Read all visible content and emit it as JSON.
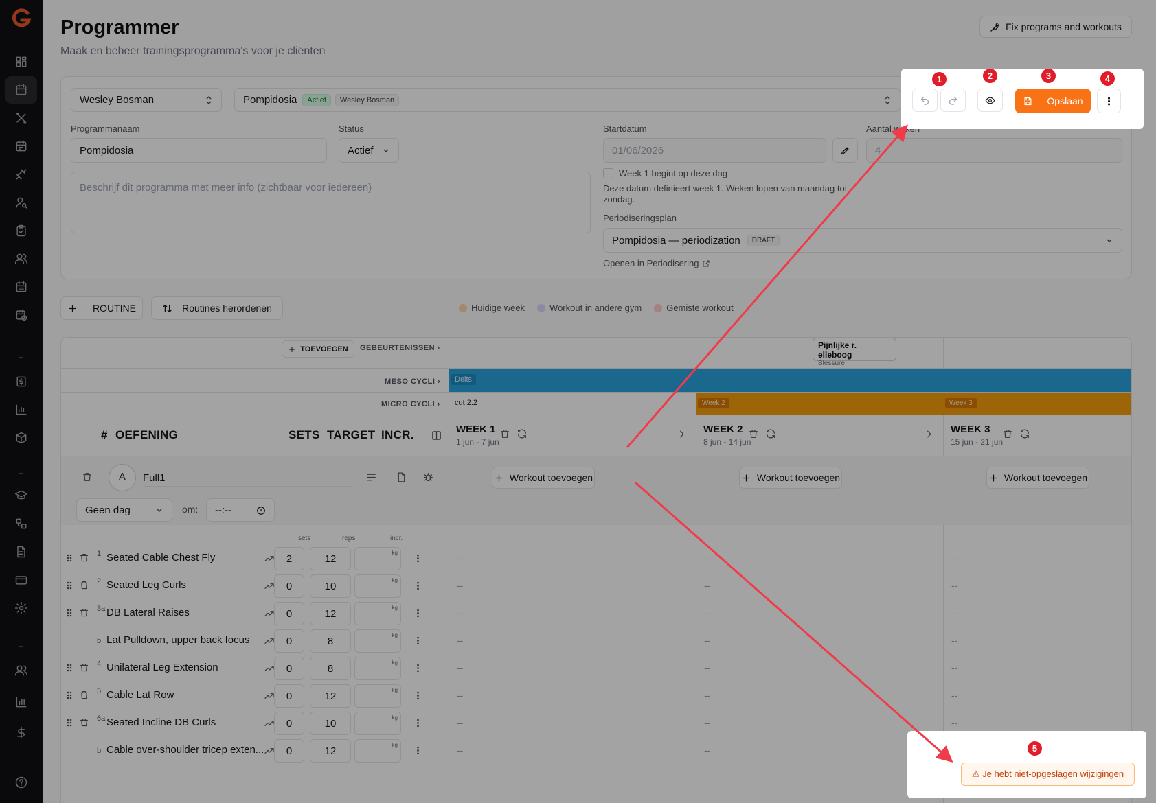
{
  "header": {
    "title": "Programmer",
    "subtitle": "Maak en beheer trainingsprogramma's voor je cliënten",
    "fix_button": "Fix programs and workouts"
  },
  "form": {
    "client_select": "Wesley Bosman",
    "program_select": "Pompidosia",
    "program_status_badge": "Actief",
    "program_owner_badge": "Wesley Bosman",
    "name_label": "Programmanaam",
    "name_value": "Pompidosia",
    "status_label": "Status",
    "status_value": "Actief",
    "description_placeholder": "Beschrijf dit programma met meer info (zichtbaar voor iedereen)",
    "start_label": "Startdatum",
    "start_value": "01/06/2026",
    "weeks_label": "Aantal weken",
    "weeks_value": "4",
    "week1_checkbox": "Week 1 begint op deze dag",
    "date_hint": "Deze datum definieert week 1. Weken lopen van maandag tot zondag.",
    "period_label": "Periodiseringsplan",
    "period_value": "Pompidosia — periodization",
    "period_badge": "DRAFT",
    "period_link": "Openen in Periodisering"
  },
  "toolbar": {
    "save_label": "Opslaan"
  },
  "actions": {
    "add_routine": "ROUTINE",
    "reorder": "Routines herordenen"
  },
  "legend": [
    {
      "label": "Huidige week",
      "color": "#fed7aa"
    },
    {
      "label": "Workout in andere gym",
      "color": "#ddd6fe"
    },
    {
      "label": "Gemiste workout",
      "color": "#fecaca"
    }
  ],
  "grid": {
    "add_event": "TOEVOEGEN",
    "events_label": "GEBEURTENISSEN ›",
    "meso_label": "MESO CYCLI ›",
    "micro_label": "MICRO CYCLI ›",
    "event_title": "Pijnlijke r. elleboog",
    "event_type": "Blessure",
    "meso_name": "Delts",
    "micro_week1": "cut 2.2",
    "micro_week2": "Week 2",
    "micro_week3": "Week 3",
    "col_num": "#",
    "col_exercise": "OEFENING",
    "col_sets": "SETS",
    "col_target": "TARGET",
    "col_incr": "INCR.",
    "weeks": [
      {
        "title": "WEEK 1",
        "range": "1 jun - 7 jun"
      },
      {
        "title": "WEEK 2",
        "range": "8 jun - 14 jun"
      },
      {
        "title": "WEEK 3",
        "range": "15 jun - 21 jun"
      }
    ],
    "add_workout": "Workout toevoegen",
    "routine_letter": "A",
    "routine_name": "Full1",
    "day_select": "Geen dag",
    "time_label": "om:",
    "time_value": "--:--",
    "sub_sets": "sets",
    "sub_reps": "reps",
    "sub_incr": "incr.",
    "kg": "kg",
    "dash": "--",
    "exercises": [
      {
        "num": "1",
        "name": "Seated Cable Chest Fly",
        "sets": "2",
        "reps": "12"
      },
      {
        "num": "2",
        "name": "Seated Leg Curls",
        "sets": "0",
        "reps": "10"
      },
      {
        "num": "3a",
        "name": "DB Lateral Raises",
        "sets": "0",
        "reps": "12"
      },
      {
        "num": "b",
        "name": "Lat Pulldown, upper back focus",
        "sets": "0",
        "reps": "8"
      },
      {
        "num": "4",
        "name": "Unilateral Leg Extension",
        "sets": "0",
        "reps": "8"
      },
      {
        "num": "5",
        "name": "Cable Lat Row",
        "sets": "0",
        "reps": "12"
      },
      {
        "num": "6a",
        "name": "Seated Incline DB Curls",
        "sets": "0",
        "reps": "10"
      },
      {
        "num": "b",
        "name": "Cable over-shoulder tricep exten...",
        "sets": "0",
        "reps": "12"
      }
    ]
  },
  "callouts": {
    "m1": "1",
    "m2": "2",
    "m3": "3",
    "m4": "4",
    "m5": "5",
    "unsaved": "⚠ Je hebt niet-opgeslagen wijzigingen"
  },
  "colors": {
    "accent": "#f97316",
    "meso": "#29a3dd",
    "micro": "#f59e0b",
    "marker": "#e11d2a"
  }
}
